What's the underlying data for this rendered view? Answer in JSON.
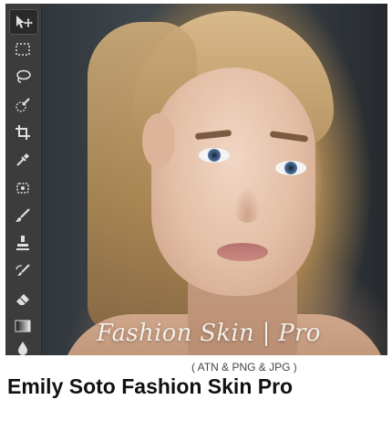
{
  "image": {
    "overlay_title": "Fashion Skin | Pro"
  },
  "toolbar": {
    "tools": [
      {
        "name": "move-icon"
      },
      {
        "name": "marquee-icon"
      },
      {
        "name": "lasso-icon"
      },
      {
        "name": "quick-selection-icon"
      },
      {
        "name": "crop-icon"
      },
      {
        "name": "eyedropper-icon"
      },
      {
        "name": "healing-brush-icon"
      },
      {
        "name": "brush-icon"
      },
      {
        "name": "clone-stamp-icon"
      },
      {
        "name": "history-brush-icon"
      },
      {
        "name": "eraser-icon"
      },
      {
        "name": "gradient-icon"
      },
      {
        "name": "blur-icon"
      }
    ],
    "background_color": "#3c3c3c",
    "icon_color": "#d8d8d8"
  },
  "caption": {
    "formats": "( ATN & PNG & JPG )",
    "product_title": "Emily Soto Fashion Skin Pro"
  }
}
